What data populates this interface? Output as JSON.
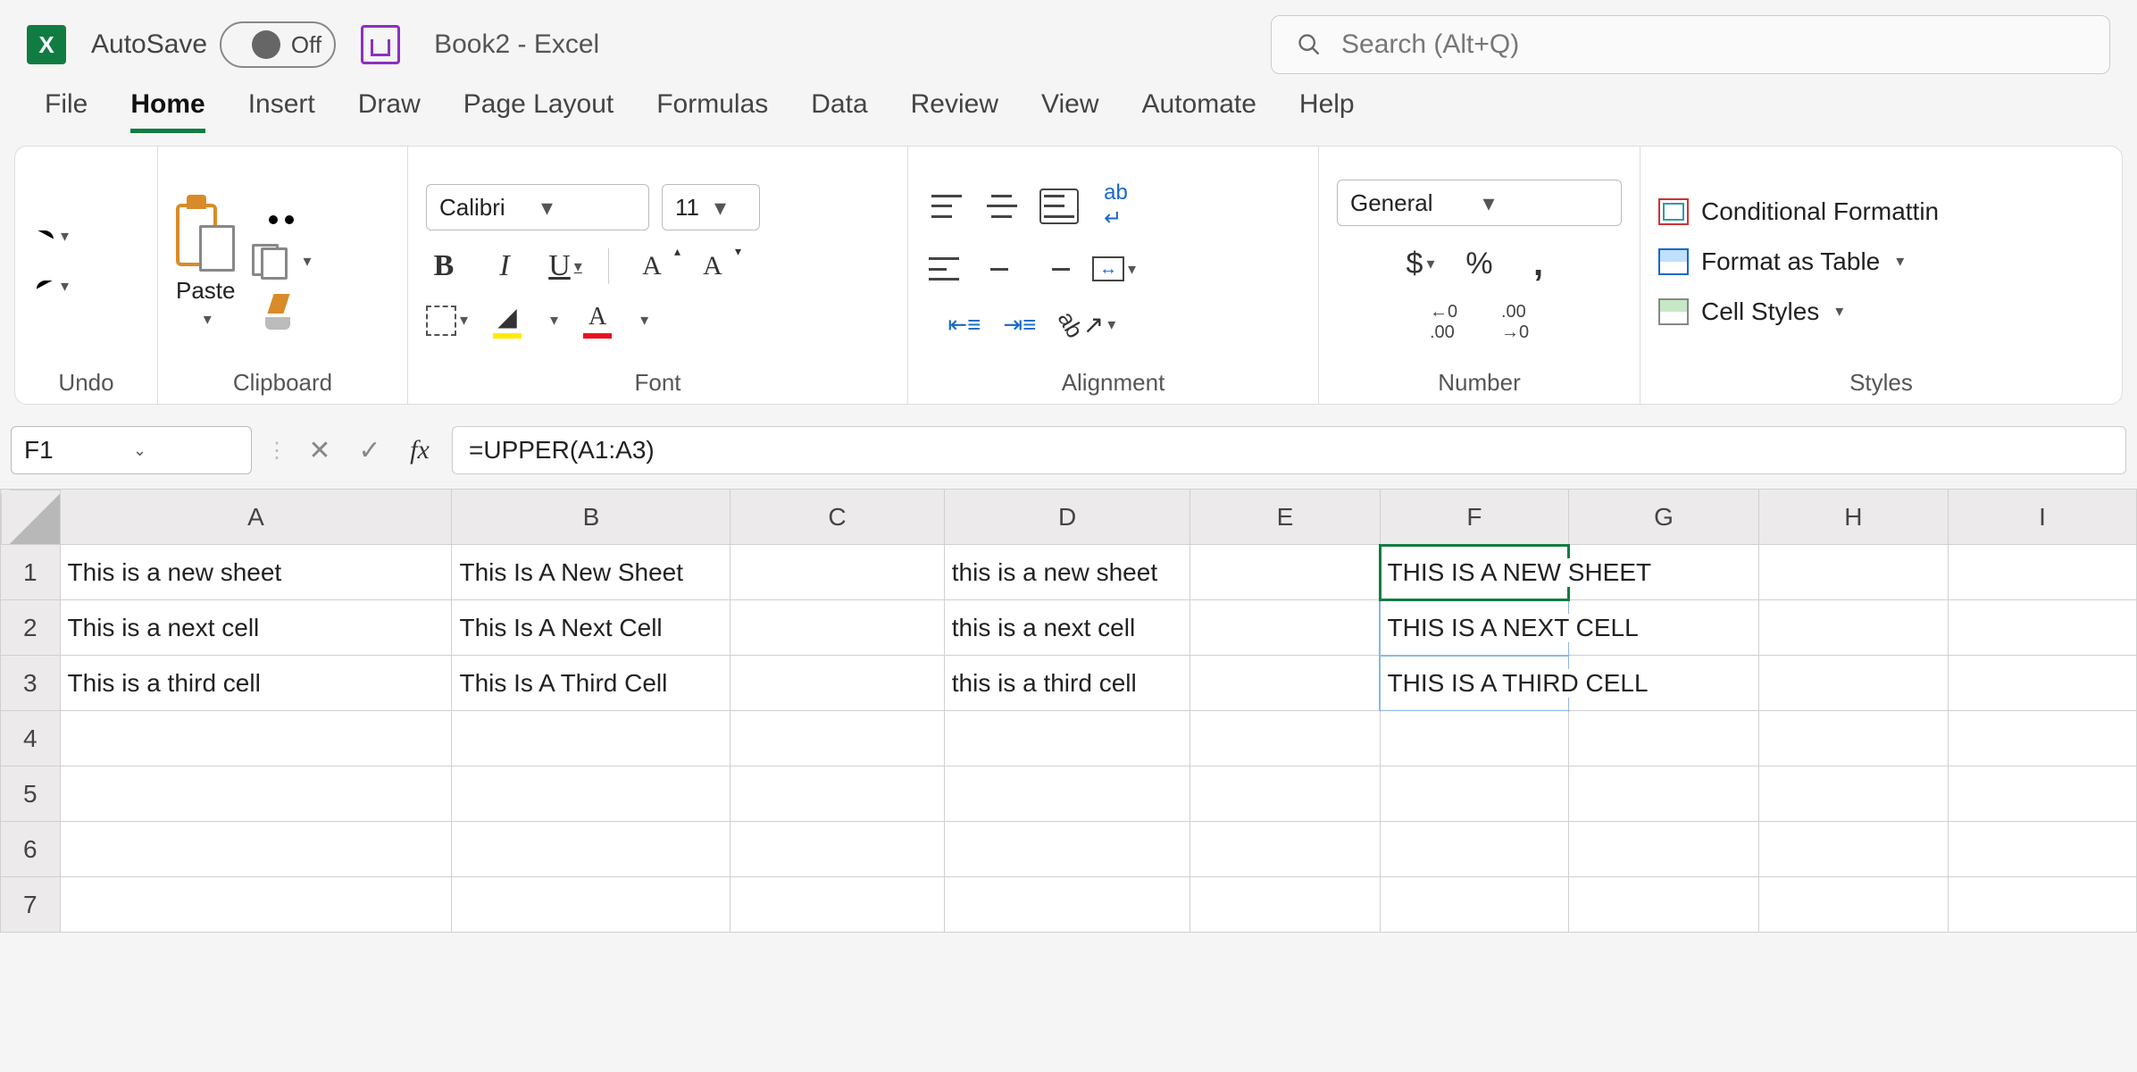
{
  "titlebar": {
    "autosave_label": "AutoSave",
    "autosave_state": "Off",
    "doc_title": "Book2  -  Excel",
    "search_placeholder": "Search (Alt+Q)"
  },
  "tabs": [
    "File",
    "Home",
    "Insert",
    "Draw",
    "Page Layout",
    "Formulas",
    "Data",
    "Review",
    "View",
    "Automate",
    "Help"
  ],
  "active_tab": "Home",
  "ribbon": {
    "undo": "Undo",
    "clipboard": {
      "caption": "Clipboard",
      "paste": "Paste"
    },
    "font": {
      "caption": "Font",
      "name": "Calibri",
      "size": "11"
    },
    "alignment": {
      "caption": "Alignment"
    },
    "number": {
      "caption": "Number",
      "format": "General"
    },
    "styles": {
      "caption": "Styles",
      "cond": "Conditional Formattin",
      "table": "Format as Table",
      "cell": "Cell Styles"
    }
  },
  "formula_bar": {
    "name_box": "F1",
    "formula": "=UPPER(A1:A3)"
  },
  "columns": [
    "A",
    "B",
    "C",
    "D",
    "E",
    "F",
    "G",
    "H",
    "I"
  ],
  "rows": [
    "1",
    "2",
    "3",
    "4",
    "5",
    "6",
    "7"
  ],
  "cells": {
    "A1": "This is a new sheet",
    "A2": "This is a next cell",
    "A3": "This is a third cell",
    "B1": "This Is A New Sheet",
    "B2": "This Is A Next Cell",
    "B3": "This Is A Third Cell",
    "D1": "this is a new sheet",
    "D2": "this is a next cell",
    "D3": "this is a third cell",
    "F1": "THIS IS A NEW SHEET",
    "F2": "THIS IS A NEXT CELL",
    "F3": "THIS IS A THIRD CELL"
  },
  "active_cell": "F1",
  "spill_range": [
    "F1",
    "F2",
    "F3"
  ]
}
